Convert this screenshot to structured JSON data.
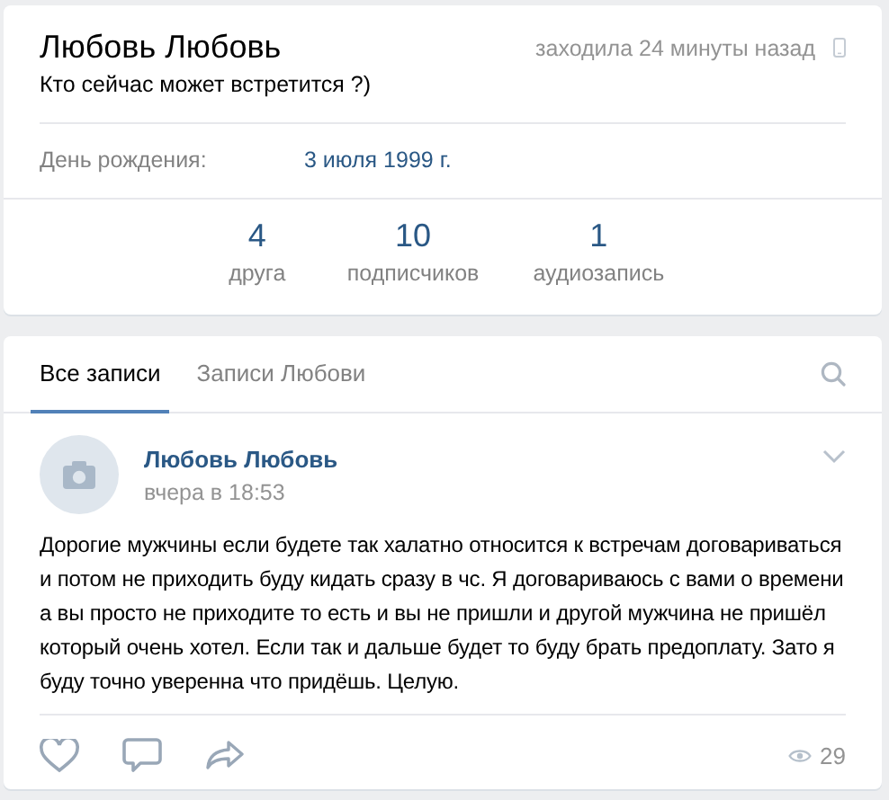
{
  "profile": {
    "name": "Любовь Любовь",
    "last_seen": "заходила 24 минуты назад",
    "status": "Кто сейчас может встретится ?)",
    "info": [
      {
        "label": "День рождения:",
        "value": "3 июля 1999 г."
      }
    ],
    "counters": [
      {
        "count": "4",
        "label": "друга"
      },
      {
        "count": "10",
        "label": "подписчиков"
      },
      {
        "count": "1",
        "label": "аудиозапись"
      }
    ]
  },
  "wall": {
    "tabs": [
      {
        "label": "Все записи",
        "selected": true
      },
      {
        "label": "Записи Любови",
        "selected": false
      }
    ],
    "post": {
      "author": "Любовь Любовь",
      "time": "вчера в 18:53",
      "text": "Дорогие мужчины если будете так халатно относится к встречам договариваться и потом не приходить буду кидать сразу в чс. Я договариваюсь с вами о времени а вы просто не приходите то есть и вы не пришли и другой мужчина не пришёл который очень хотел. Если так и дальше будет то буду брать предоплату. Зато я буду точно уверенна что придёшь. Целую.",
      "views": "29"
    }
  }
}
